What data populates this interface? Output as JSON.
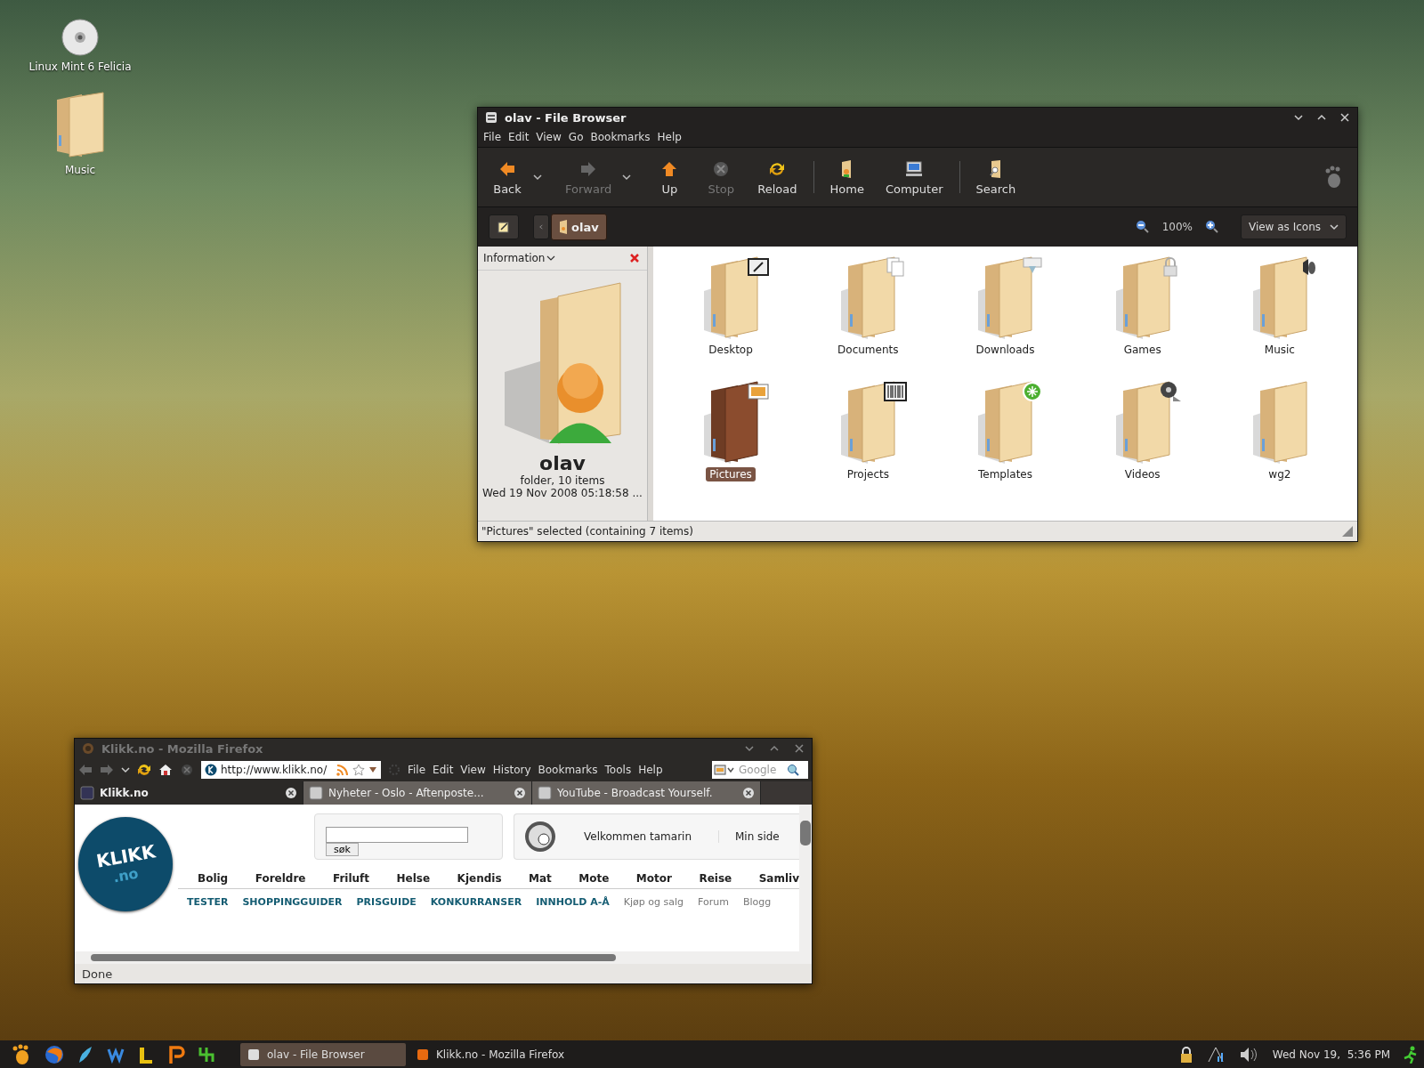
{
  "desktop_icons": [
    {
      "label": "Linux Mint 6 Felicia",
      "kind": "disc"
    },
    {
      "label": "Music",
      "kind": "folder"
    }
  ],
  "file_browser": {
    "title": "olav - File Browser",
    "menu": [
      "File",
      "Edit",
      "View",
      "Go",
      "Bookmarks",
      "Help"
    ],
    "toolbar": [
      {
        "label": "Back",
        "kind": "back",
        "disabled": false,
        "dropdown": true
      },
      {
        "label": "Forward",
        "kind": "forward",
        "disabled": true,
        "dropdown": true
      },
      {
        "label": "Up",
        "kind": "up",
        "disabled": false,
        "dropdown": false
      },
      {
        "label": "Stop",
        "kind": "stop",
        "disabled": true,
        "dropdown": false
      },
      {
        "label": "Reload",
        "kind": "reload",
        "disabled": false,
        "dropdown": false
      },
      {
        "label": "Home",
        "kind": "home",
        "disabled": false,
        "dropdown": false
      },
      {
        "label": "Computer",
        "kind": "computer",
        "disabled": false,
        "dropdown": false
      },
      {
        "label": "Search",
        "kind": "search",
        "disabled": false,
        "dropdown": false
      }
    ],
    "path": "olav",
    "zoom": "100%",
    "view_mode": "View as Icons",
    "sidebar": {
      "title": "Information",
      "name": "olav",
      "details": [
        "folder, 10 items",
        "Wed 19 Nov 2008 05:18:58 ..."
      ]
    },
    "items": [
      {
        "label": "Desktop",
        "kind": "note",
        "selected": false
      },
      {
        "label": "Documents",
        "kind": "documents",
        "selected": false
      },
      {
        "label": "Downloads",
        "kind": "download",
        "selected": false
      },
      {
        "label": "Games",
        "kind": "lock",
        "selected": false
      },
      {
        "label": "Music",
        "kind": "speaker",
        "selected": false
      },
      {
        "label": "Pictures",
        "kind": "picture",
        "selected": true
      },
      {
        "label": "Projects",
        "kind": "barcode",
        "selected": false
      },
      {
        "label": "Templates",
        "kind": "star",
        "selected": false
      },
      {
        "label": "Videos",
        "kind": "film",
        "selected": false
      },
      {
        "label": "wg2",
        "kind": "plain",
        "selected": false
      }
    ],
    "status": "\"Pictures\" selected (containing 7 items)"
  },
  "firefox": {
    "title": "Klikk.no - Mozilla Firefox",
    "url": "http://www.klikk.no/",
    "menu": [
      "File",
      "Edit",
      "View",
      "History",
      "Bookmarks",
      "Tools",
      "Help"
    ],
    "search_placeholder": "Google",
    "tabs": [
      {
        "label": "Klikk.no",
        "selected": true
      },
      {
        "label": "Nyheter - Oslo - Aftenposte...",
        "selected": false
      },
      {
        "label": "YouTube - Broadcast Yourself.",
        "selected": false
      }
    ],
    "page": {
      "logo": "KLIKK",
      "logo_sub": ".no",
      "search_button": "søk",
      "welcome": "Velkommen tamarin",
      "my_page": "Min side",
      "categories": [
        "Bolig",
        "Foreldre",
        "Friluft",
        "Helse",
        "Kjendis",
        "Mat",
        "Mote",
        "Motor",
        "Reise",
        "Samliv"
      ],
      "links": [
        {
          "label": "TESTER",
          "kind": "feature"
        },
        {
          "label": "SHOPPINGGUIDER",
          "kind": "feature"
        },
        {
          "label": "PRISGUIDE",
          "kind": "feature"
        },
        {
          "label": "KONKURRANSER",
          "kind": "feature"
        },
        {
          "label": "INNHOLD A-Å",
          "kind": "feature"
        },
        {
          "label": "Kjøp og salg",
          "kind": "plain"
        },
        {
          "label": "Forum",
          "kind": "plain"
        },
        {
          "label": "Blogg",
          "kind": "plain"
        }
      ]
    },
    "status": "Done"
  },
  "taskbar": {
    "tasks": [
      {
        "label": "olav - File Browser",
        "selected": true
      },
      {
        "label": "Klikk.no - Mozilla Firefox",
        "selected": false
      }
    ],
    "clock": "Wed Nov 19,  5:36 PM"
  }
}
